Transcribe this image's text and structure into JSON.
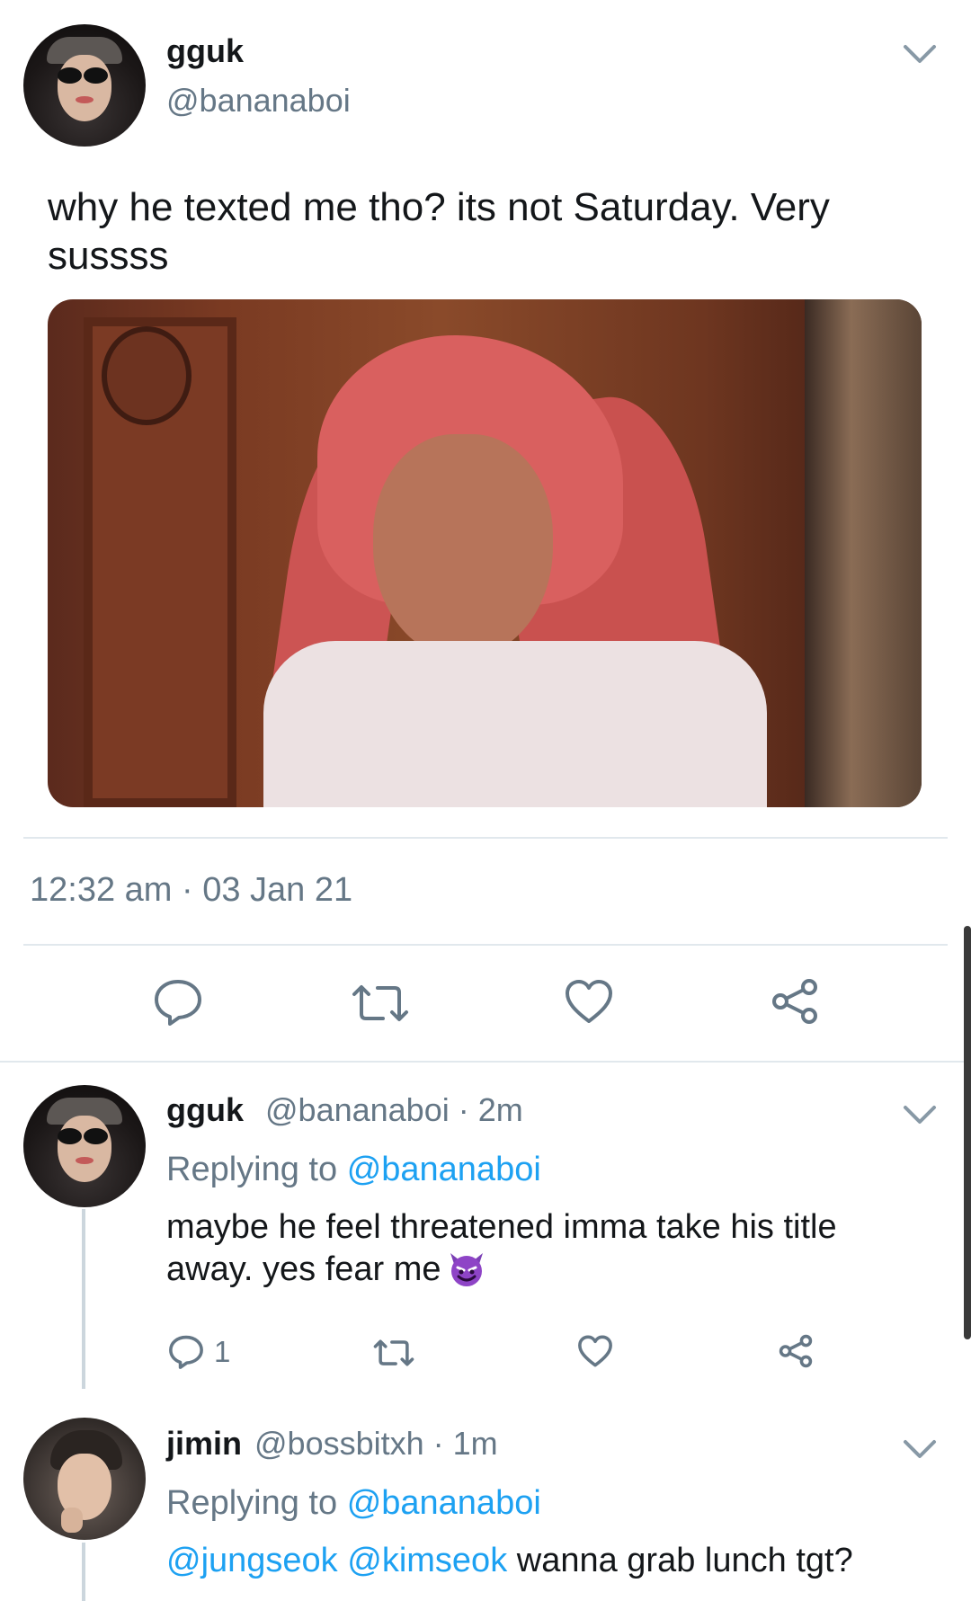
{
  "tweet": {
    "author_name": "gguk",
    "author_handle": "@bananaboi",
    "text": "why he texted me tho? its not Saturday. Very sussss",
    "timestamp": "12:32 am · 03 Jan 21"
  },
  "replies": [
    {
      "author_name": "gguk",
      "meta": "@bananaboi · 2m",
      "replying_label": "Replying to",
      "replying_to": "@bananaboi",
      "text": "maybe he feel threatened imma take his title away. yes fear me",
      "emoji": "smiling-imp-emoji",
      "reply_count": "1"
    },
    {
      "author_name": "jimin",
      "meta": "@bossbitxh · 1m",
      "replying_label": "Replying to",
      "replying_to": "@bananaboi",
      "mention_1": "@jungseok",
      "mention_2": "@kimseok",
      "text": "wanna grab lunch tgt?"
    }
  ],
  "icons": {
    "reply": "reply-icon",
    "retweet": "retweet-icon",
    "like": "heart-icon",
    "share": "share-icon",
    "more": "chevron-down-icon"
  },
  "colors": {
    "text": "#14171a",
    "secondary": "#657786",
    "link": "#1da1f2",
    "divider": "#e1e8ed"
  }
}
